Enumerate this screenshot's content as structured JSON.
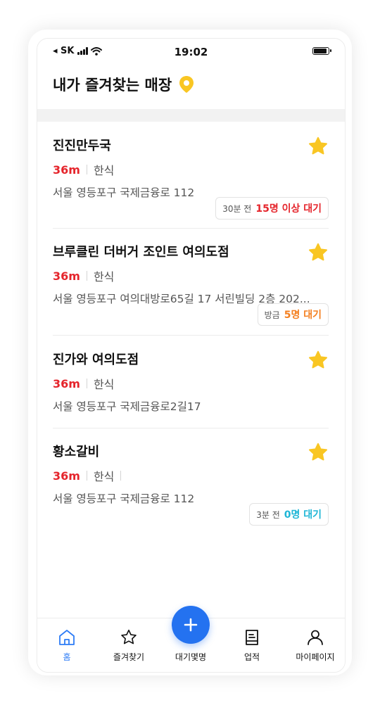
{
  "status_bar": {
    "carrier": "◂ SK",
    "time": "19:02"
  },
  "header": {
    "title": "내가 즐겨찾는 매장",
    "icon": "location-pin-icon",
    "pin_color": "#f9c623"
  },
  "colors": {
    "distance": "#e5252c",
    "star": "#f9c623",
    "fab": "#2472f0",
    "active_tab": "#2d7cf6"
  },
  "stores": [
    {
      "name": "진진만두국",
      "distance": "36m",
      "category": "한식",
      "address": "서울 영등포구 국제금융로 112",
      "wait": {
        "time": "30분 전",
        "count": "15명 이상 대기",
        "color": "#e5252c"
      },
      "favorited": true
    },
    {
      "name": "브루클린 더버거 조인트 여의도점",
      "distance": "36m",
      "category": "한식",
      "address": "서울 영등포구 여의대방로65길 17 서린빌딩 2층 202...",
      "wait": {
        "time": "방금",
        "count": "5명 대기",
        "color": "#f47f1f"
      },
      "favorited": true
    },
    {
      "name": "진가와 여의도점",
      "distance": "36m",
      "category": "한식",
      "address": "서울 영등포구 국제금융로2길17",
      "favorited": true
    },
    {
      "name": "황소갈비",
      "distance": "36m",
      "category": "한식",
      "address": "서울 영등포구 국제금융로 112",
      "wait": {
        "time": "3분 전",
        "count": "0명 대기",
        "color": "#1fb6d6"
      },
      "favorited": true
    }
  ],
  "tabs": [
    {
      "label": "홈",
      "icon": "home-icon",
      "active": true
    },
    {
      "label": "즐겨찾기",
      "icon": "star-outline-icon"
    },
    {
      "label": "대기몇명",
      "icon": "plus-icon"
    },
    {
      "label": "업적",
      "icon": "receipt-icon"
    },
    {
      "label": "마이페이지",
      "icon": "person-icon"
    }
  ]
}
